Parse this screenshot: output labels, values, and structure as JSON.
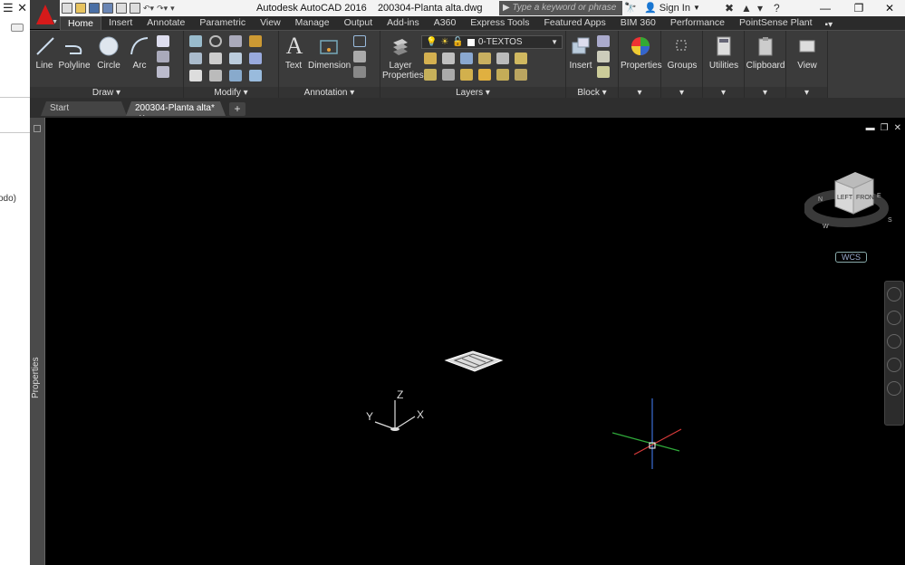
{
  "external_window": {
    "icon_label": "☰",
    "close_label": "✕",
    "clipped_text": "odo)"
  },
  "titlebar": {
    "app_title": "Autodesk AutoCAD 2016",
    "file_name": "200304-Planta alta.dwg",
    "search_placeholder": "Type a keyword or phrase",
    "signin_label": "Sign In",
    "help_label": "?"
  },
  "ribbon_tabs": [
    "Home",
    "Insert",
    "Annotate",
    "Parametric",
    "View",
    "Manage",
    "Output",
    "Add-ins",
    "A360",
    "Express Tools",
    "Featured Apps",
    "BIM 360",
    "Performance",
    "PointSense Plant"
  ],
  "ribbon_tabs_extra": "▪▾",
  "ribbon": {
    "draw": {
      "title": "Draw",
      "line": "Line",
      "polyline": "Polyline",
      "circle": "Circle",
      "arc": "Arc"
    },
    "modify": {
      "title": "Modify"
    },
    "annotation": {
      "title": "Annotation",
      "text": "Text",
      "dimension": "Dimension"
    },
    "layers": {
      "title": "Layers",
      "layer_properties_1": "Layer",
      "layer_properties_2": "Properties",
      "current_layer": "0-TEXTOS"
    },
    "block": {
      "title": "Block",
      "insert": "Insert"
    },
    "properties": {
      "label": "Properties"
    },
    "groups": {
      "label": "Groups"
    },
    "utilities": {
      "label": "Utilities"
    },
    "clipboard": {
      "label": "Clipboard"
    },
    "view": {
      "label": "View"
    }
  },
  "document_tabs": {
    "start": "Start",
    "active": "200304-Planta alta*",
    "close": "✕",
    "new": "+"
  },
  "properties_palette": {
    "label": "Properties"
  },
  "viewcube": {
    "left": "LEFT",
    "front": "FRONT",
    "compass_n": "N",
    "compass_s": "S",
    "compass_w": "W",
    "compass_e": "E"
  },
  "wcs_label": "WCS",
  "ucs_icon": {
    "x": "X",
    "y": "Y",
    "z": "Z"
  },
  "colors": {
    "accent_red": "#d61a1a",
    "ribbon_bg": "#3b3b3b",
    "canvas_bg": "#000000"
  }
}
